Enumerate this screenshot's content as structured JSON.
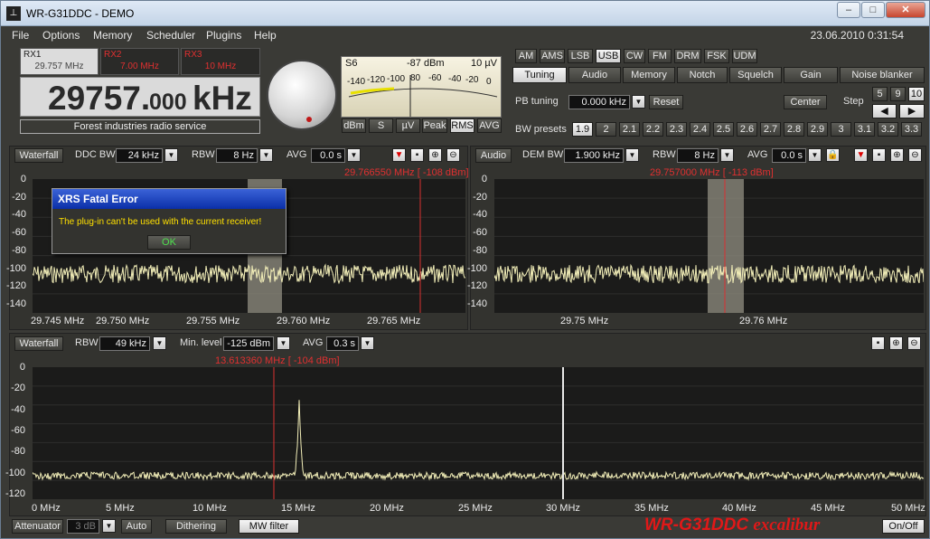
{
  "window": {
    "title": "WR-G31DDC - DEMO",
    "date": "23.06.2010 0:31:54"
  },
  "menu": [
    "File",
    "Options",
    "Memory",
    "Scheduler",
    "Plugins",
    "Help"
  ],
  "rx": {
    "tabs": [
      {
        "name": "RX1",
        "freq": "29.757 MHz"
      },
      {
        "name": "RX2",
        "freq": "7.00 MHz"
      },
      {
        "name": "RX3",
        "freq": "10 MHz"
      }
    ],
    "big_freq_main": "29757.",
    "big_freq_dec": "000",
    "big_freq_unit": "kHz",
    "service": "Forest industries radio service"
  },
  "smeter": {
    "s_label": "S6",
    "dbm": "-87 dBm",
    "uv": "10 µV",
    "scale": [
      "-140",
      "-120",
      "-100",
      "80",
      "-60",
      "-40",
      "-20",
      "0"
    ],
    "buttons": [
      "dBm",
      "S",
      "µV",
      "Peak",
      "RMS",
      "AVG"
    ]
  },
  "modes": [
    "AM",
    "AMS",
    "LSB",
    "USB",
    "CW",
    "FM",
    "DRM",
    "FSK",
    "UDM"
  ],
  "selected_mode": "USB",
  "func_tabs": [
    "Tuning",
    "Audio",
    "Memory",
    "Notch",
    "Squelch",
    "Gain",
    "Noise blanker"
  ],
  "tuning": {
    "pb_label": "PB tuning",
    "pb_value": "0.000 kHz",
    "reset": "Reset",
    "center": "Center",
    "step_label": "Step",
    "steps": [
      "5",
      "9",
      "10"
    ],
    "bw_label": "BW presets",
    "bw_presets": [
      "1.9",
      "2",
      "2.1",
      "2.2",
      "2.3",
      "2.4",
      "2.5",
      "2.6",
      "2.7",
      "2.8",
      "2.9",
      "3",
      "3.1",
      "3.2",
      "3.3"
    ]
  },
  "ddc": {
    "waterfall": "Waterfall",
    "ddc_bw_label": "DDC BW",
    "ddc_bw": "24 kHz",
    "rbw_label": "RBW",
    "rbw": "8 Hz",
    "avg_label": "AVG",
    "avg": "0.0 s",
    "marker": "29.766550 MHz [ -108 dBm]",
    "yticks": [
      "0",
      "-20",
      "-40",
      "-60",
      "-80",
      "-100",
      "-120",
      "-140"
    ],
    "xticks": [
      "29.745 MHz",
      "29.750 MHz",
      "29.755 MHz",
      "29.760 MHz",
      "29.765 MHz"
    ]
  },
  "dem": {
    "audio": "Audio",
    "dem_bw_label": "DEM BW",
    "dem_bw": "1.900 kHz",
    "rbw_label": "RBW",
    "rbw": "8 Hz",
    "avg_label": "AVG",
    "avg": "0.0 s",
    "marker": "29.757000 MHz [ -113 dBm]",
    "yticks": [
      "0",
      "-20",
      "-40",
      "-60",
      "-80",
      "-100",
      "-120",
      "-140"
    ],
    "xticks": [
      "29.75 MHz",
      "29.76 MHz"
    ]
  },
  "wide": {
    "waterfall": "Waterfall",
    "rbw_label": "RBW",
    "rbw": "49 kHz",
    "min_level_label": "Min. level",
    "min_level": "-125 dBm",
    "avg_label": "AVG",
    "avg": "0.3 s",
    "marker": "13.613360 MHz [ -104 dBm]",
    "yticks": [
      "0",
      "-20",
      "-40",
      "-60",
      "-80",
      "-100",
      "-120"
    ],
    "xticks": [
      "0 MHz",
      "5 MHz",
      "10 MHz",
      "15 MHz",
      "20 MHz",
      "25 MHz",
      "30 MHz",
      "35 MHz",
      "40 MHz",
      "45 MHz",
      "50 MHz"
    ]
  },
  "bottom": {
    "attenuator": "Attenuator",
    "att_value": "3 dB",
    "auto": "Auto",
    "dithering": "Dithering",
    "mw_filter": "MW filter",
    "logo": "WR-G31DDC",
    "logo2": "excalibur",
    "onoff": "On/Off"
  },
  "dialog": {
    "title": "XRS Fatal Error",
    "message": "The plug-in can't be used with the current receiver!",
    "ok": "OK"
  }
}
